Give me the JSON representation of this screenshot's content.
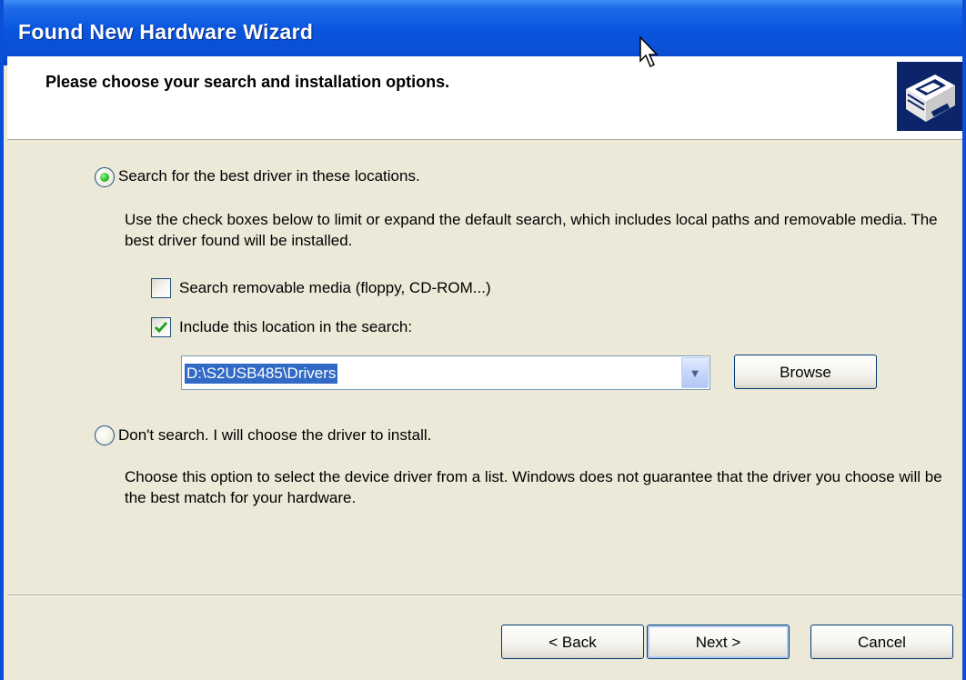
{
  "window": {
    "title": "Found New Hardware Wizard"
  },
  "header": {
    "title": "Please choose your search and installation options.",
    "icon": "hardware-wizard-icon"
  },
  "options": {
    "search": {
      "label": "Search for the best driver in these locations.",
      "selected": true,
      "description": "Use the check boxes below to limit or expand the default search, which includes local paths and removable media. The best driver found will be installed."
    },
    "removable_media": {
      "label": "Search removable media (floppy, CD-ROM...)",
      "checked": false
    },
    "include_location": {
      "label": "Include this location in the search:",
      "checked": true
    },
    "location": {
      "value": "D:\\S2USB485\\Drivers"
    },
    "browse_label": "Browse",
    "dont_search": {
      "label": "Don't search. I will choose the driver to install.",
      "selected": false,
      "description": "Choose this option to select the device driver from a list.  Windows does not guarantee that the driver you choose will be the best match for your hardware."
    }
  },
  "footer": {
    "back_label": "< Back",
    "next_label": "Next >",
    "cancel_label": "Cancel"
  },
  "colors": {
    "title_bar": "#0a55de",
    "dialog_bg": "#ece9d8",
    "selection": "#316ac5",
    "radio_dot": "#2ec22a"
  }
}
